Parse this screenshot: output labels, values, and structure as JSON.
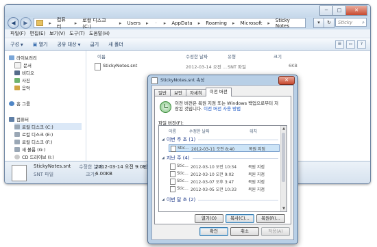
{
  "explorer": {
    "window_controls": [
      "─",
      "□",
      "✕"
    ],
    "breadcrumbs": [
      "컴퓨터",
      "로컬 디스크 (C:)",
      "Users",
      "AppData",
      "Roaming",
      "Microsoft",
      "Sticky Notes"
    ],
    "search_placeholder": "Sticky Not...",
    "menu": [
      "파일(F)",
      "편집(E)",
      "보기(V)",
      "도구(T)",
      "도움말(H)"
    ],
    "commands": [
      "구성",
      "열기",
      "공유 대상",
      "굽기",
      "새 폴더"
    ],
    "nav": {
      "library": "라이브러리",
      "library_items": [
        "문서",
        "비디오",
        "사진",
        "음악"
      ],
      "homegroup": "홈 그룹",
      "computer": "컴퓨터",
      "drives": [
        "로컬 디스크 (C:)",
        "로컬 디스크 (E:)",
        "로컬 디스크 (F:)",
        "새 볼륨 (G:)",
        "CD 드라이브 (I:)"
      ]
    },
    "columns": [
      "이름",
      "수정한 날짜",
      "유형",
      "크기"
    ],
    "files": [
      {
        "name": "StickyNotes.snt",
        "modified": "2012-03-14 오전 ...",
        "type": "SNT 파일",
        "size": "6KB"
      }
    ],
    "details": {
      "name": "StickyNotes.snt",
      "modified_label": "수정한 날짜:",
      "modified_value": "2012-03-14 오전 9:08",
      "created_partial": "만든",
      "type": "SNT 파일",
      "size_label": "크기:",
      "size_value": "6.00KB"
    }
  },
  "dialog": {
    "title": "StickyNotes.snt 속성",
    "close": "✕",
    "tabs": [
      "일반",
      "보안",
      "자세히",
      "이전 버전"
    ],
    "info_line1": "이전 버전은 복원 지점 또는 Windows 백업으로부터 저",
    "info_line2": "장된 것입니다.",
    "info_link": "이전 버전 사용 방법",
    "versions_label": "파일 버전(F):",
    "list_columns": [
      "이름",
      "수정한 날짜",
      "위치"
    ],
    "groups": [
      {
        "label": "이번 주 초 (1)",
        "rows": [
          {
            "name": "Stic...",
            "date": "2012-03-11 오전 8:40",
            "location": "복원 지점",
            "selected": true
          }
        ]
      },
      {
        "label": "지난 주 (4)",
        "rows": [
          {
            "name": "Stic...",
            "date": "2012-03-10 오전 10:34",
            "location": "복원 지점",
            "selected": false
          },
          {
            "name": "Stic...",
            "date": "2012-03-10 오전 9:02",
            "location": "복원 지점",
            "selected": false
          },
          {
            "name": "Stic...",
            "date": "2012-03-07 오후 3:47",
            "location": "복원 지점",
            "selected": false
          },
          {
            "name": "Stic...",
            "date": "2012-03-05 오전 10:33",
            "location": "복원 지점",
            "selected": false
          }
        ]
      },
      {
        "label": "이번 달 초 (2)",
        "rows": []
      }
    ],
    "tab_buttons": [
      "열기(O)",
      "복사(C)...",
      "복원(R)..."
    ],
    "footer_buttons": [
      "확인",
      "취소",
      "적용(A)"
    ]
  }
}
